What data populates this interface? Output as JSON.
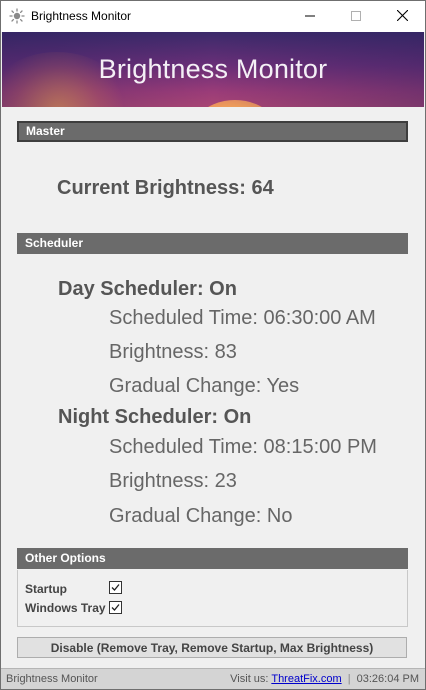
{
  "window": {
    "title": "Brightness Monitor"
  },
  "banner": {
    "title": "Brightness Monitor"
  },
  "master": {
    "header": "Master",
    "current_brightness": "Current Brightness: 64"
  },
  "scheduler": {
    "header": "Scheduler",
    "day": {
      "title": "Day Scheduler: On",
      "time": "Scheduled Time: 06:30:00 AM",
      "brightness": "Brightness: 83",
      "gradual": "Gradual Change: Yes"
    },
    "night": {
      "title": "Night Scheduler: On",
      "time": "Scheduled Time: 08:15:00 PM",
      "brightness": "Brightness: 23",
      "gradual": "Gradual Change: No"
    }
  },
  "other_options": {
    "header": "Other Options",
    "items": [
      {
        "label": "Startup",
        "checked": true
      },
      {
        "label": "Windows Tray",
        "checked": true
      }
    ]
  },
  "disable_button": "Disable (Remove Tray, Remove Startup, Max Brightness)",
  "statusbar": {
    "app_name": "Brightness Monitor",
    "visit_prefix": "Visit us:",
    "link_text": "ThreatFix.com",
    "separator": "|",
    "time": "03:26:04 PM"
  },
  "colors": {
    "section_header": "#6b6b6b",
    "link": "#0000cc",
    "statusbar": "#d4d4d4"
  },
  "icons": [
    "sun-icon",
    "minimize-icon",
    "maximize-icon",
    "close-icon",
    "checkmark-icon"
  ]
}
